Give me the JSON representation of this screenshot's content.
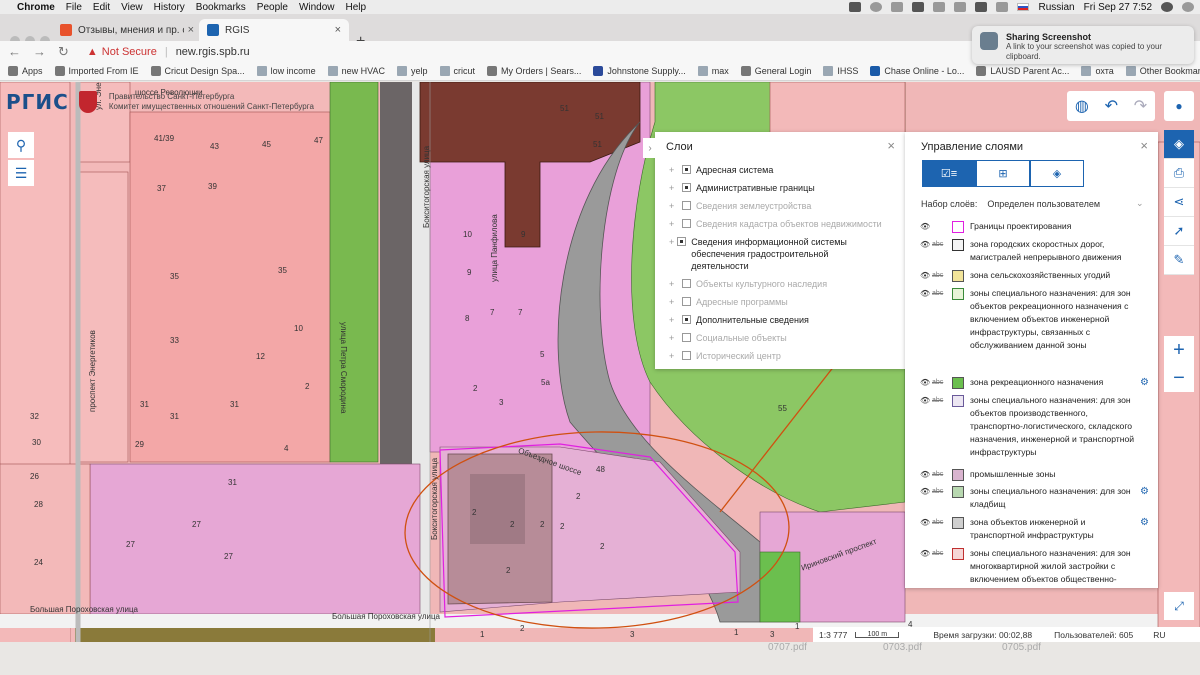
{
  "menubar": {
    "apple": "",
    "app_name": "Chrome",
    "items": [
      "File",
      "Edit",
      "View",
      "History",
      "Bookmarks",
      "People",
      "Window",
      "Help"
    ],
    "input_language": "Russian",
    "datetime": "Fri Sep 27  7:52"
  },
  "tabs": [
    {
      "label": "Отзывы, мнения и пр. о ЖК «",
      "active": false,
      "favicon_color": "#e8522c"
    },
    {
      "label": "RGIS",
      "active": true,
      "favicon_color": "#1d64b0"
    }
  ],
  "address": {
    "security": "Not Secure",
    "url": "new.rgis.spb.ru"
  },
  "bookmarks": {
    "apps_label": "Apps",
    "items": [
      "Imported From IE",
      "Cricut Design Spa...",
      "low income",
      "new HVAC",
      "yelp",
      "cricut",
      "My Orders | Sears...",
      "Johnstone Supply...",
      "max",
      "General Login",
      "IHSS",
      "Chase Online - Lo...",
      "LAUSD Parent Ac...",
      "охта"
    ],
    "other": "Other Bookmarks"
  },
  "notification": {
    "title": "Sharing Screenshot",
    "body": "A link to your screenshot was copied to your clipboard."
  },
  "logo": {
    "text": "РГИС",
    "org_line1": "Правительство Санкт-Петербурга",
    "org_line2": "Комитет имущественных отношений Санкт-Петербурга"
  },
  "layers_panel": {
    "title": "Слои",
    "items": [
      {
        "label": "Адресная система",
        "checked": true,
        "enabled": true
      },
      {
        "label": "Административные границы",
        "checked": true,
        "enabled": true
      },
      {
        "label": "Сведения землеустройства",
        "checked": false,
        "enabled": false
      },
      {
        "label": "Сведения кадастра объектов недвижимости",
        "checked": false,
        "enabled": false
      },
      {
        "label": "Сведения информационной системы обеспечения градостроительной деятельности",
        "checked": true,
        "enabled": true
      },
      {
        "label": "Объекты культурного наследия",
        "checked": false,
        "enabled": false
      },
      {
        "label": "Адресные программы",
        "checked": false,
        "enabled": false
      },
      {
        "label": "Дополнительные сведения",
        "checked": true,
        "enabled": true
      },
      {
        "label": "Социальные объекты",
        "checked": false,
        "enabled": false
      },
      {
        "label": "Исторический центр",
        "checked": false,
        "enabled": false
      }
    ]
  },
  "mgmt_panel": {
    "title": "Управление слоями",
    "preset_label": "Набор слоёв:",
    "preset_value": "Определен пользователем",
    "rows": [
      {
        "label": "Границы проектирования",
        "swatch": "#ffffff",
        "border": "#e020e0",
        "abc": false,
        "gear": false
      },
      {
        "label": "зона городских скоростных дорог, магистралей непрерывного движения",
        "swatch": "#f4f4f4",
        "border": "#333333",
        "abc": true,
        "gear": false
      },
      {
        "label": "зона сельскохозяйственных угодий",
        "swatch": "#f2e49a",
        "border": "#555555",
        "abc": true,
        "gear": false
      },
      {
        "label": "зоны специального назначения: для зон объектов рекреационного назначения с включением объектов инженерной инфраструктуры, связанных с обслуживанием данной зоны",
        "swatch": "#e8f4d8",
        "border": "#3a8a3a",
        "abc": true,
        "gear": false
      },
      {
        "label": "зона рекреационного назначения",
        "swatch": "#6bbf4e",
        "border": "#555555",
        "abc": true,
        "gear": true
      },
      {
        "label": "зоны специального назначения: для зон объектов производственного, транспортно-логистического, складского назначения, инженерной и транспортной инфраструктуры",
        "swatch": "#ece6f2",
        "border": "#6a5a9a",
        "abc": true,
        "gear": false
      },
      {
        "label": "промышленные зоны",
        "swatch": "#d9b4cf",
        "border": "#555555",
        "abc": true,
        "gear": false
      },
      {
        "label": "зоны специального назначения: для зон кладбищ",
        "swatch": "#b8d8b0",
        "border": "#555555",
        "abc": true,
        "gear": true
      },
      {
        "label": "зона объектов инженерной и транспортной инфраструктуры",
        "swatch": "#cfcfcf",
        "border": "#555555",
        "abc": true,
        "gear": true
      },
      {
        "label": "зоны специального назначения: для зон многоквартирной жилой застройки с включением объектов общественно-",
        "swatch": "#f6d6d6",
        "border": "#c03030",
        "abc": true,
        "gear": false
      }
    ]
  },
  "map": {
    "numbers": [
      {
        "t": "41/39"
      },
      {
        "t": "43"
      },
      {
        "t": "45"
      },
      {
        "t": "47"
      },
      {
        "t": "37"
      },
      {
        "t": "39"
      },
      {
        "t": "35"
      },
      {
        "t": "35"
      },
      {
        "t": "33"
      },
      {
        "t": "31"
      },
      {
        "t": "31"
      },
      {
        "t": "29"
      },
      {
        "t": "31"
      },
      {
        "t": "10"
      },
      {
        "t": "12"
      },
      {
        "t": "2"
      },
      {
        "t": "4"
      },
      {
        "t": "30"
      },
      {
        "t": "32"
      },
      {
        "t": "28"
      },
      {
        "t": "26"
      },
      {
        "t": "24"
      },
      {
        "t": "27"
      },
      {
        "t": "27"
      },
      {
        "t": "27"
      },
      {
        "t": "31"
      },
      {
        "t": "51"
      },
      {
        "t": "51"
      },
      {
        "t": "51"
      },
      {
        "t": "9"
      },
      {
        "t": "10"
      },
      {
        "t": "9"
      },
      {
        "t": "7"
      },
      {
        "t": "7"
      },
      {
        "t": "8"
      },
      {
        "t": "5"
      },
      {
        "t": "3"
      },
      {
        "t": "5а"
      },
      {
        "t": "2"
      },
      {
        "t": "55"
      },
      {
        "t": "48"
      },
      {
        "t": "2"
      },
      {
        "t": "2"
      },
      {
        "t": "2"
      },
      {
        "t": "2"
      },
      {
        "t": "2"
      },
      {
        "t": "2"
      },
      {
        "t": "2"
      },
      {
        "t": "3"
      },
      {
        "t": "2"
      },
      {
        "t": "1"
      },
      {
        "t": "1"
      },
      {
        "t": "3"
      },
      {
        "t": "1"
      },
      {
        "t": "4"
      }
    ],
    "streets": [
      {
        "t": "ул. Энергетиков"
      },
      {
        "t": "шоссе Революции"
      },
      {
        "t": "улица Петра Смородина"
      },
      {
        "t": "Бокситогорская улица"
      },
      {
        "t": "улица Панфилова"
      },
      {
        "t": "проспект Энергетиков"
      },
      {
        "t": "Бокситогорская улица"
      },
      {
        "t": "Объездное шоссе"
      },
      {
        "t": "Ириновский проспект"
      },
      {
        "t": "Большая Пороховская улица"
      },
      {
        "t": "Большая Пороховская улица"
      }
    ]
  },
  "status": {
    "scale": "1:3 777",
    "scalebar_label": "100 m",
    "load_time": "Время загрузки: 00:02,88",
    "users": "Пользователей: 605",
    "lang": "RU"
  },
  "desktop_files": [
    "0707.pdf",
    "0703.pdf",
    "0705.pdf"
  ]
}
